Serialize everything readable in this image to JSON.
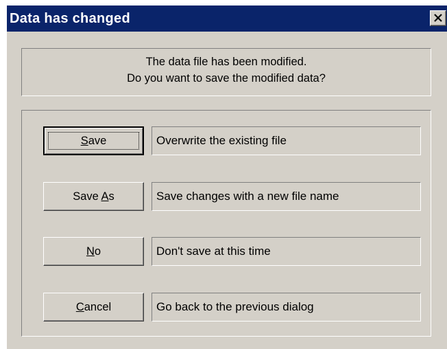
{
  "window": {
    "title": "Data has changed",
    "close_icon": "close-icon"
  },
  "message": {
    "line1": "The data file has been modified.",
    "line2": "Do you want to save the modified data?"
  },
  "options": [
    {
      "label": "Save",
      "mnemonic": "S",
      "description": "Overwrite the existing file",
      "default": true
    },
    {
      "label": "Save As",
      "mnemonic": "A",
      "description": "Save changes with a new file name",
      "default": false
    },
    {
      "label": "No",
      "mnemonic": "N",
      "description": "Don't save at this time",
      "default": false
    },
    {
      "label": "Cancel",
      "mnemonic": "C",
      "description": "Go back to the previous dialog",
      "default": false
    }
  ],
  "colors": {
    "titlebar": "#0a246a",
    "face": "#d4d0c8"
  }
}
